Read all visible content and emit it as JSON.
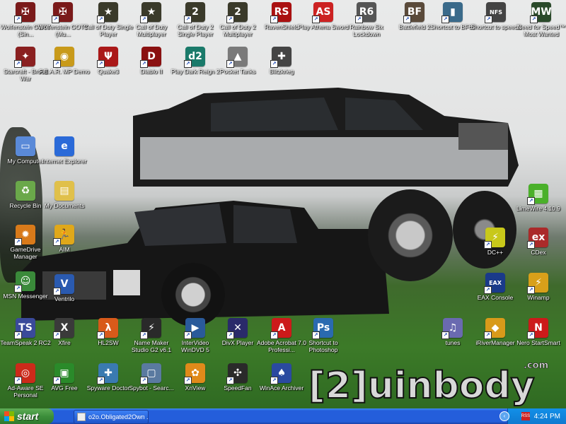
{
  "desktop": {
    "icons": [
      {
        "id": "wolf1",
        "label": "Wolfenstein GOTY (Sin...",
        "icon": "wolfenstein-icon",
        "color": "#7a1a1a",
        "glyph": "✠"
      },
      {
        "id": "wolf2",
        "label": "Wolfenstein GOTY (Mu...",
        "icon": "wolfenstein-icon",
        "color": "#7a1a1a",
        "glyph": "✠"
      },
      {
        "id": "cod1",
        "label": "Call of Duty Single Player",
        "icon": "call-of-duty-icon",
        "color": "#3a3a2a",
        "glyph": "★"
      },
      {
        "id": "cod2",
        "label": "Call of Duty Multiplayer",
        "icon": "call-of-duty-icon",
        "color": "#3a3a2a",
        "glyph": "★"
      },
      {
        "id": "cod3",
        "label": "Call of Duty 2 Single Player",
        "icon": "call-of-duty-2-icon",
        "color": "#3a3a2a",
        "glyph": "2"
      },
      {
        "id": "cod4",
        "label": "Call of Duty 2 Multiplayer",
        "icon": "call-of-duty-2-icon",
        "color": "#3a3a2a",
        "glyph": "2"
      },
      {
        "id": "rs",
        "label": "RavenShield",
        "icon": "ravenshield-icon",
        "color": "#aa1010",
        "glyph": "RS"
      },
      {
        "id": "athena",
        "label": "Play Athena Sword",
        "icon": "athena-sword-icon",
        "color": "#cc2222",
        "glyph": "AS"
      },
      {
        "id": "r6",
        "label": "Rainbow Six Lockdown",
        "icon": "rainbow-six-icon",
        "color": "#555555",
        "glyph": "R6"
      },
      {
        "id": "bf2",
        "label": "Battlefield 2",
        "icon": "battlefield-icon",
        "color": "#5a4a3a",
        "glyph": "BF"
      },
      {
        "id": "bf67",
        "label": "Shortcut to BF67",
        "icon": "battlefield-shortcut-icon",
        "color": "#3a6a8a",
        "glyph": "▮"
      },
      {
        "id": "speed2",
        "label": "Shortcut to speed2",
        "icon": "nfs-shortcut-icon",
        "color": "#444444",
        "glyph": "NFS"
      },
      {
        "id": "nfsmw",
        "label": "Need for Speed™ Most Wanted",
        "icon": "nfs-most-wanted-icon",
        "color": "#2a4a2a",
        "glyph": "MW"
      },
      {
        "id": "starcraft",
        "label": "Starcraft - Brood War",
        "icon": "starcraft-icon",
        "color": "#8a2020",
        "glyph": "✦"
      },
      {
        "id": "fear",
        "label": "F.E.A.R. MP Demo",
        "icon": "fear-icon",
        "color": "#c89a1a",
        "glyph": "◉"
      },
      {
        "id": "quake",
        "label": "Quake3",
        "icon": "quake-icon",
        "color": "#aa1818",
        "glyph": "Ψ"
      },
      {
        "id": "diablo",
        "label": "Diablo II",
        "icon": "diablo-icon",
        "color": "#8a1010",
        "glyph": "D"
      },
      {
        "id": "darkreign",
        "label": "Play Dark Reign 2",
        "icon": "dark-reign-icon",
        "color": "#1a7a6a",
        "glyph": "d2"
      },
      {
        "id": "pockettanks",
        "label": "Pocket Tanks",
        "icon": "pocket-tanks-icon",
        "color": "#7a7a7a",
        "glyph": "▲"
      },
      {
        "id": "blitzkrieg",
        "label": "Blitzkrieg",
        "icon": "blitzkrieg-icon",
        "color": "#444444",
        "glyph": "✚"
      },
      {
        "id": "mycomputer",
        "label": "My Computer",
        "icon": "my-computer-icon",
        "color": "#5a8ad8",
        "glyph": "▭"
      },
      {
        "id": "ie",
        "label": "Internet Explorer",
        "icon": "internet-explorer-icon",
        "color": "#2a6ad8",
        "glyph": "e"
      },
      {
        "id": "recycle",
        "label": "Recycle Bin",
        "icon": "recycle-bin-icon",
        "color": "#6aa84a",
        "glyph": "♻"
      },
      {
        "id": "mydocs",
        "label": "My Documents",
        "icon": "my-documents-icon",
        "color": "#e0c04a",
        "glyph": "▤"
      },
      {
        "id": "gamedrive",
        "label": "GameDrive Manager",
        "icon": "gamedrive-icon",
        "color": "#d87a1a",
        "glyph": "✹"
      },
      {
        "id": "aim",
        "label": "AIM",
        "icon": "aim-icon",
        "color": "#e0a81a",
        "glyph": "🏃"
      },
      {
        "id": "msn",
        "label": "MSN Messenger",
        "icon": "msn-messenger-icon",
        "color": "#3a8a3a",
        "glyph": "☺"
      },
      {
        "id": "ventrilo",
        "label": "Ventrilo",
        "icon": "ventrilo-icon",
        "color": "#2a5ab0",
        "glyph": "V"
      },
      {
        "id": "limewire",
        "label": "LimeWire 4.10.9",
        "icon": "limewire-icon",
        "color": "#4ab02a",
        "glyph": "▦"
      },
      {
        "id": "dcpp",
        "label": "DC++",
        "icon": "dcpp-icon",
        "color": "#c8c81a",
        "glyph": "⚡"
      },
      {
        "id": "cdex",
        "label": "CDex",
        "icon": "cdex-icon",
        "color": "#aa2a2a",
        "glyph": "ex"
      },
      {
        "id": "eax",
        "label": "EAX Console",
        "icon": "eax-console-icon",
        "color": "#1a3a8a",
        "glyph": "EAX"
      },
      {
        "id": "winamp",
        "label": "Winamp",
        "icon": "winamp-icon",
        "color": "#d8a01a",
        "glyph": "⚡"
      },
      {
        "id": "ts2",
        "label": "TeamSpeak 2 RC2",
        "icon": "teamspeak-icon",
        "color": "#3a4a9a",
        "glyph": "TS"
      },
      {
        "id": "xfire",
        "label": "Xfire",
        "icon": "xfire-icon",
        "color": "#3a3a3a",
        "glyph": "X"
      },
      {
        "id": "hl2",
        "label": "HL2SW",
        "icon": "hl2sw-icon",
        "color": "#d85a1a",
        "glyph": "λ"
      },
      {
        "id": "namemaker",
        "label": "Name Maker Studio G2 v6.1",
        "icon": "name-maker-icon",
        "color": "#2a2a2a",
        "glyph": "⚡"
      },
      {
        "id": "windvd",
        "label": "InterVideo WinDVD 5",
        "icon": "windvd-icon",
        "color": "#2a5a9a",
        "glyph": "▶"
      },
      {
        "id": "divx",
        "label": "DivX Player",
        "icon": "divx-player-icon",
        "color": "#2a2a6a",
        "glyph": "✕"
      },
      {
        "id": "acrobat",
        "label": "Adobe Acrobat 7.0 Professi...",
        "icon": "acrobat-icon",
        "color": "#cc1a1a",
        "glyph": "A"
      },
      {
        "id": "photoshop",
        "label": "Shortcut to Photoshop",
        "icon": "photoshop-shortcut-icon",
        "color": "#2a6ab0",
        "glyph": "Ps"
      },
      {
        "id": "itunes",
        "label": "tunes",
        "icon": "itunes-icon",
        "color": "#6a6ab0",
        "glyph": "♫"
      },
      {
        "id": "iriver",
        "label": "iRiverManager",
        "icon": "iriver-icon",
        "color": "#d89a1a",
        "glyph": "◆"
      },
      {
        "id": "nero",
        "label": "Nero StartSmart",
        "icon": "nero-icon",
        "color": "#cc1a1a",
        "glyph": "N"
      },
      {
        "id": "adaware",
        "label": "Ad-Aware SE Personal",
        "icon": "adaware-icon",
        "color": "#cc2a1a",
        "glyph": "◎"
      },
      {
        "id": "avg",
        "label": "AVG Free",
        "icon": "avg-icon",
        "color": "#2a8a2a",
        "glyph": "▣"
      },
      {
        "id": "spyware",
        "label": "Spyware Doctor",
        "icon": "spyware-doctor-icon",
        "color": "#3a7ab0",
        "glyph": "✚"
      },
      {
        "id": "spybot",
        "label": "Spybot - Searc...",
        "icon": "spybot-icon",
        "color": "#5a7aa0",
        "glyph": "▢"
      },
      {
        "id": "xnview",
        "label": "XnView",
        "icon": "xnview-icon",
        "color": "#e08a1a",
        "glyph": "✿"
      },
      {
        "id": "speedfan",
        "label": "SpeedFan",
        "icon": "speedfan-icon",
        "color": "#2a2a2a",
        "glyph": "✣"
      },
      {
        "id": "winace",
        "label": "WinAce Archiver",
        "icon": "winace-icon",
        "color": "#2a4aa0",
        "glyph": "♠"
      }
    ],
    "wallpaper": {
      "logo_text": "[2]uinbody",
      "logo_suffix": ".com"
    }
  },
  "taskbar": {
    "start_label": "start",
    "task_item_label": "o2o.Obligated2Own ...",
    "tray_icon_label": "RSS",
    "clock": "4:24 PM",
    "colors": {
      "taskbar": "#245edb",
      "start": "#3c8f3b",
      "tray": "#0f7ad0"
    }
  }
}
